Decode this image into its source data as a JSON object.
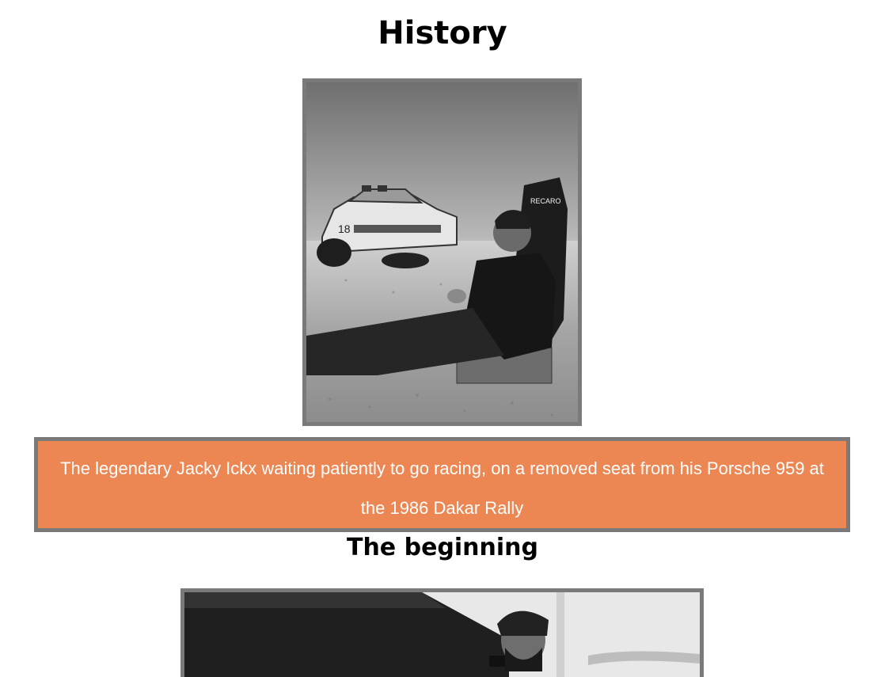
{
  "page": {
    "title": "History",
    "section_heading": "The beginning"
  },
  "figure_1": {
    "image_name": "desert-rally-driver-photo",
    "seat_brand_text": "RECARO",
    "caption": "The legendary Jacky Ickx waiting patiently to go racing, on a removed seat from his Porsche 959 at the 1986 Dakar Rally"
  },
  "figure_2": {
    "image_name": "bearded-man-photo"
  },
  "colors": {
    "caption_background": "#ec8653",
    "frame_border": "#7a7a7a",
    "caption_text": "#ffffff"
  }
}
